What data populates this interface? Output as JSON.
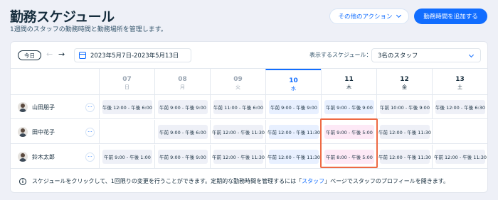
{
  "header": {
    "title": "勤務スケジュール",
    "subtitle": "1週間のスタッフの勤務時間と勤務場所を管理します。",
    "actions_label": "その他のアクション",
    "add_label": "勤務時間を追加する"
  },
  "toolbar": {
    "today_label": "今日",
    "date_range": "2023年5月7日-2023年5月13日",
    "schedule_label": "表示するスケジュール：",
    "schedule_value": "3名のスタッフ"
  },
  "days": [
    {
      "num": "07",
      "dow": "日"
    },
    {
      "num": "08",
      "dow": "月"
    },
    {
      "num": "09",
      "dow": "火"
    },
    {
      "num": "10",
      "dow": "水"
    },
    {
      "num": "11",
      "dow": "木"
    },
    {
      "num": "12",
      "dow": "金"
    },
    {
      "num": "13",
      "dow": "土"
    }
  ],
  "staff": [
    {
      "name": "山田朋子",
      "more": "···",
      "shifts": [
        "午後 12:00 - 午後 6:00",
        "午前 9:00 - 午後 9:00",
        "午前 11:00 - 午後 6:00",
        "午前 9:00 - 午後 9:00",
        "午前 9:00 - 午後 9:00",
        "午前 10:00 - 午後 9:00",
        "午後 12:00 - 午後 6:30"
      ]
    },
    {
      "name": "田中花子",
      "more": "···",
      "shifts": [
        "",
        "午前 9:00 - 午後 6:00",
        "午前 12:00 - 午後 11:30",
        "午前 12:00 - 午後 11:30",
        "午前 9:00 - 午後 5:00",
        "午前 12:00 - 午後 11:30",
        ""
      ]
    },
    {
      "name": "鈴木太郎",
      "more": "···",
      "shifts": [
        "午前 9:00 - 午後 1:00",
        "午前 9:00 - 午後 9:00",
        "午前 12:00 - 午後 11:30",
        "午前 12:00 - 午後 11:30",
        "午前 8:00 - 午後 5:00",
        "午前 12:00 - 午後 11:30",
        "午前 12:00 - 午後 11:30"
      ]
    }
  ],
  "info": {
    "text_before": "スケジュールをクリックして、1回限りの変更を行うことができます。定期的な勤務時間を管理するには「",
    "link": "スタッフ",
    "text_after": "」ページでスタッフのプロフィールを開きます。"
  },
  "colors": {
    "accent": "#116dff",
    "highlight_border": "#ee6a44",
    "highlight_fill": "#fde9f6"
  }
}
